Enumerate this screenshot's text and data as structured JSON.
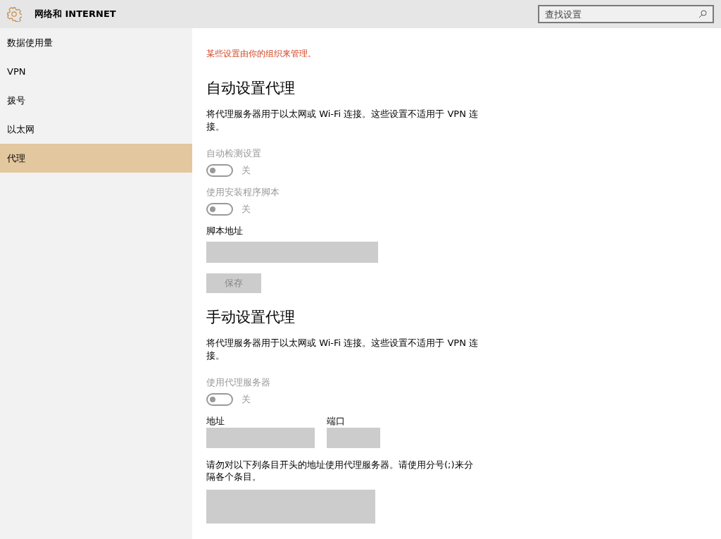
{
  "header": {
    "title": "网络和 INTERNET",
    "search": {
      "placeholder": "查找设置"
    }
  },
  "sidebar": {
    "items": [
      {
        "label": "数据使用量",
        "selected": false
      },
      {
        "label": "VPN",
        "selected": false
      },
      {
        "label": "拨号",
        "selected": false
      },
      {
        "label": "以太网",
        "selected": false
      },
      {
        "label": "代理",
        "selected": true
      }
    ]
  },
  "content": {
    "notice": "某些设置由你的组织来管理。",
    "sections": [
      {
        "heading": "自动设置代理",
        "description": "将代理服务器用于以太网或 Wi-Fi 连接。这些设置不适用于 VPN 连接。",
        "controls": [
          {
            "kind": "toggle",
            "label": "自动检测设置",
            "on": false,
            "disabled": true,
            "state_text": "关"
          },
          {
            "kind": "toggle",
            "label": "使用安装程序脚本",
            "on": false,
            "disabled": true,
            "state_text": "关"
          },
          {
            "kind": "field",
            "label": "脚本地址",
            "disabled": true
          },
          {
            "kind": "button",
            "label": "保存",
            "disabled": true
          }
        ]
      },
      {
        "heading": "手动设置代理",
        "description": "将代理服务器用于以太网或 Wi-Fi 连接。这些设置不适用于 VPN 连接。",
        "controls": [
          {
            "kind": "toggle",
            "label": "使用代理服务器",
            "on": false,
            "disabled": true,
            "state_text": "关"
          },
          {
            "kind": "field_pair",
            "fields": [
              {
                "label": "地址",
                "disabled": true
              },
              {
                "label": "端口",
                "disabled": true
              }
            ]
          },
          {
            "kind": "textarea",
            "label": "请勿对以下列条目开头的地址使用代理服务器。请使用分号(;)来分隔各个条目。",
            "disabled": true
          }
        ]
      }
    ]
  }
}
